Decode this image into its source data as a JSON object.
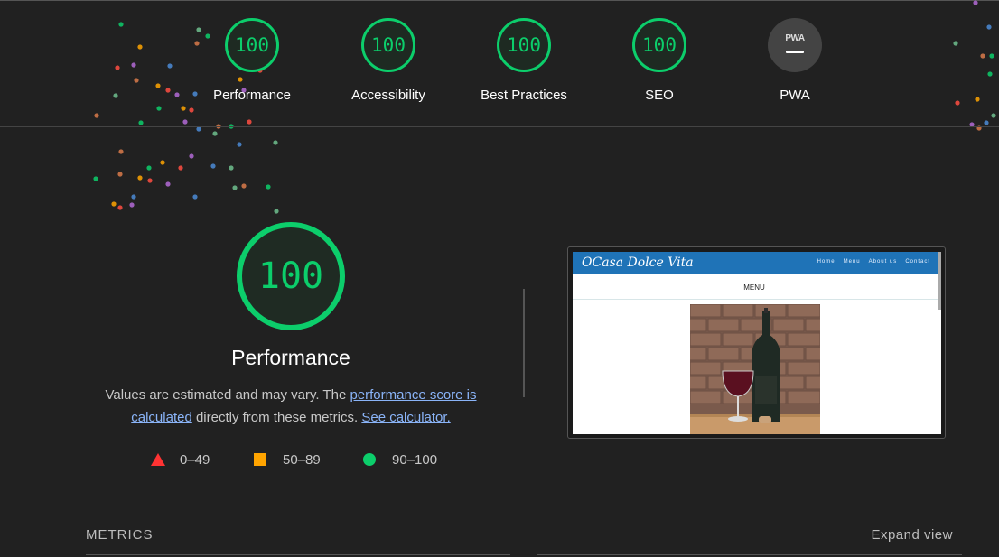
{
  "header": {
    "gauges": [
      {
        "score": "100",
        "label": "Performance"
      },
      {
        "score": "100",
        "label": "Accessibility"
      },
      {
        "score": "100",
        "label": "Best Practices"
      },
      {
        "score": "100",
        "label": "SEO"
      }
    ],
    "pwa": {
      "badge_text": "PWA",
      "label": "PWA"
    }
  },
  "performance": {
    "score": "100",
    "title": "Performance",
    "desc_prefix": "Values are estimated and may vary. The ",
    "link_score": "performance score is calculated",
    "desc_middle": " directly from these metrics. ",
    "link_calculator": "See calculator.",
    "legend": [
      {
        "range": "0–49",
        "color": "#ff3333"
      },
      {
        "range": "50–89",
        "color": "#ffa400"
      },
      {
        "range": "90–100",
        "color": "#0cce6b"
      }
    ]
  },
  "screenshot": {
    "logo": "OCasa Dolce Vita",
    "nav_links": [
      "Home",
      "Menu",
      "About us",
      "Contact"
    ],
    "active_link": "Menu",
    "section_title": "MENU"
  },
  "metrics": {
    "title": "METRICS",
    "expand_label": "Expand view"
  },
  "colors": {
    "pass": "#0cce6b",
    "average": "#ffa400",
    "fail": "#ff3333",
    "background": "#212121",
    "link": "#8ab4f8"
  }
}
